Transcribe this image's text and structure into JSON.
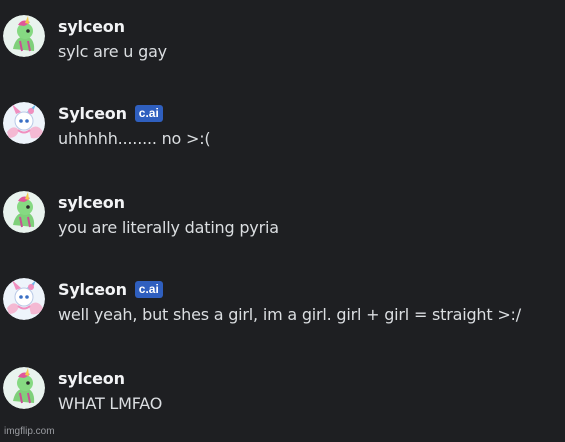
{
  "messages": [
    {
      "username": "sylceon",
      "bot": false,
      "text": "sylc are u gay"
    },
    {
      "username": "Sylceon",
      "bot": true,
      "badge": "c.ai",
      "text": "uhhhhh........ no >:("
    },
    {
      "username": "sylceon",
      "bot": false,
      "text": "you are literally dating pyria"
    },
    {
      "username": "Sylceon",
      "bot": true,
      "badge": "c.ai",
      "text": "well yeah, but shes a girl, im a girl. girl + girl = straight >:/"
    },
    {
      "username": "sylceon",
      "bot": false,
      "text": "WHAT LMFAO"
    }
  ],
  "watermark": "imgflip.com",
  "colors": {
    "background": "#1e1f22",
    "username": "#f2f3f5",
    "message_text": "#dbdee1",
    "badge": "#2f5fbf"
  },
  "icons": {
    "user_avatar": "green-pony-avatar-icon",
    "bot_avatar": "sylveon-avatar-icon"
  }
}
